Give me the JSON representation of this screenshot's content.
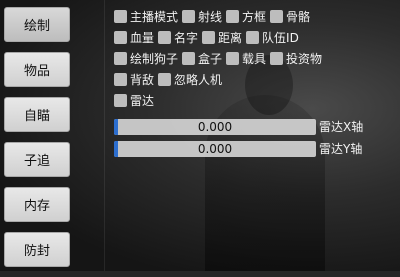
{
  "sidebar": {
    "items": [
      {
        "label": "绘制"
      },
      {
        "label": "物品"
      },
      {
        "label": "自瞄"
      },
      {
        "label": "子追"
      },
      {
        "label": "内存"
      },
      {
        "label": "防封"
      }
    ]
  },
  "options": {
    "row1": [
      "主播模式",
      "射线",
      "方框",
      "骨骼"
    ],
    "row2": [
      "血量",
      "名字",
      "距离",
      "队伍ID"
    ],
    "row3": [
      "绘制狗子",
      "盒子",
      "载具",
      "投资物"
    ],
    "row4": [
      "背敌",
      "忽略人机"
    ],
    "row5": [
      "雷达"
    ]
  },
  "sliders": [
    {
      "value": "0.000",
      "label": "雷达X轴"
    },
    {
      "value": "0.000",
      "label": "雷达Y轴"
    }
  ]
}
